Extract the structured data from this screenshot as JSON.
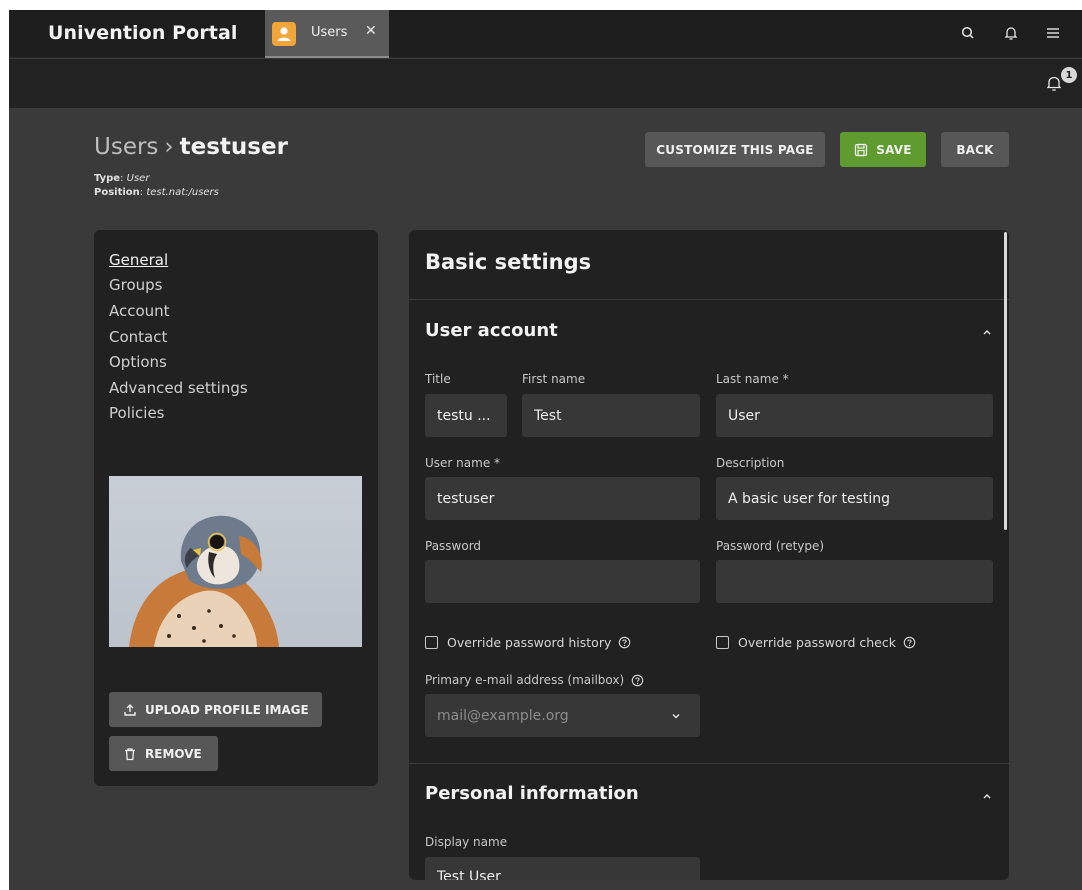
{
  "app": {
    "brand": "Univention Portal",
    "tab_label": "Users",
    "tab_close": "✕",
    "notification_count": "1"
  },
  "header": {
    "breadcrumb_parent": "Users",
    "breadcrumb_sep": "›",
    "breadcrumb_current": "testuser",
    "type_label": "Type",
    "type_value": "User",
    "position_label": "Position",
    "position_value": "test.nat:/users",
    "customize_label": "CUSTOMIZE THIS PAGE",
    "save_label": "SAVE",
    "back_label": "BACK"
  },
  "nav": {
    "items": [
      "General",
      "Groups",
      "Account",
      "Contact",
      "Options",
      "Advanced settings",
      "Policies"
    ],
    "upload_label": "UPLOAD PROFILE IMAGE",
    "remove_label": "REMOVE"
  },
  "main": {
    "title": "Basic settings",
    "user_account": {
      "heading": "User account",
      "title_label": "Title",
      "title_value": "testu ...",
      "first_name_label": "First name",
      "first_name_value": "Test",
      "last_name_label": "Last name *",
      "last_name_value": "User",
      "username_label": "User name *",
      "username_value": "testuser",
      "description_label": "Description",
      "description_value": "A basic user for testing",
      "password_label": "Password",
      "password_value": "",
      "password_retype_label": "Password (retype)",
      "password_retype_value": "",
      "override_history_label": "Override password history",
      "override_check_label": "Override password check",
      "email_label": "Primary e-mail address (mailbox)",
      "email_placeholder": "mail@example.org"
    },
    "personal_info": {
      "heading": "Personal information",
      "display_name_label": "Display name",
      "display_name_value": "Test User"
    }
  },
  "colors": {
    "accent_save": "#5f9b2f",
    "tab_icon": "#f2a53b",
    "background": "#3a3a3a",
    "card": "#212121"
  },
  "icons": [
    "user-icon",
    "close-icon",
    "search-icon",
    "bell-icon",
    "menu-icon",
    "save-icon",
    "upload-icon",
    "trash-icon",
    "chevron-up-icon",
    "chevron-down-icon",
    "help-icon"
  ]
}
